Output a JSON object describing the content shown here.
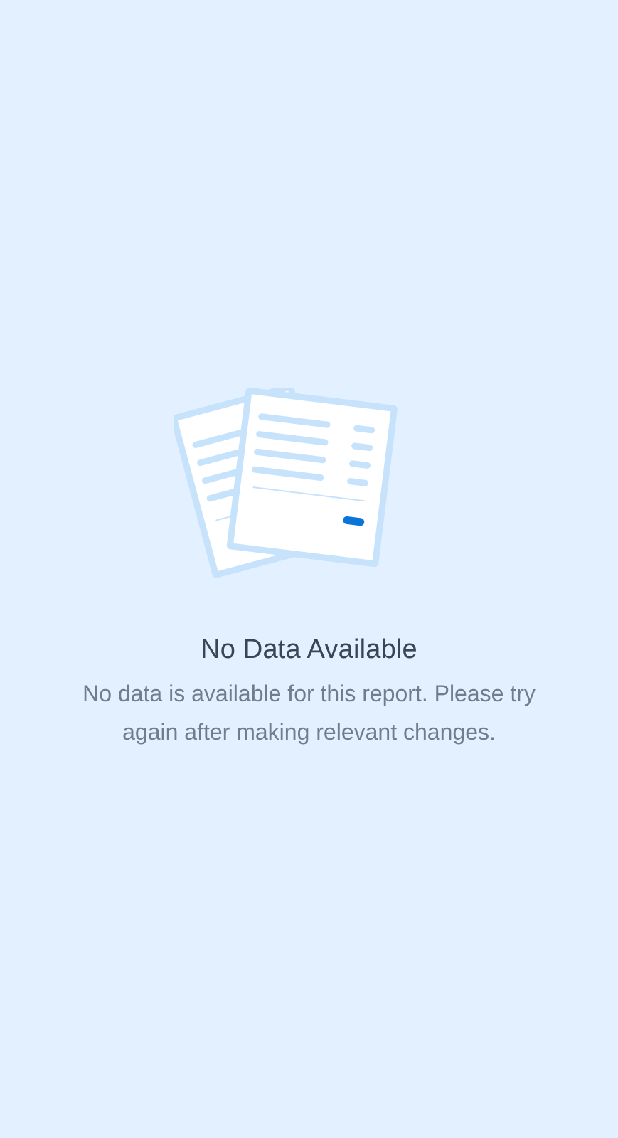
{
  "empty_state": {
    "illustration_icon": "documents-icon",
    "title": "No Data Available",
    "message": "No data is available for this report. Please try again after making relevant changes."
  },
  "colors": {
    "background": "#e2f0ff",
    "illustration_outline": "#c7e2fb",
    "illustration_paper": "#ffffff",
    "accent": "#0a74d9",
    "title": "#3a4555",
    "message": "#717d8d"
  }
}
